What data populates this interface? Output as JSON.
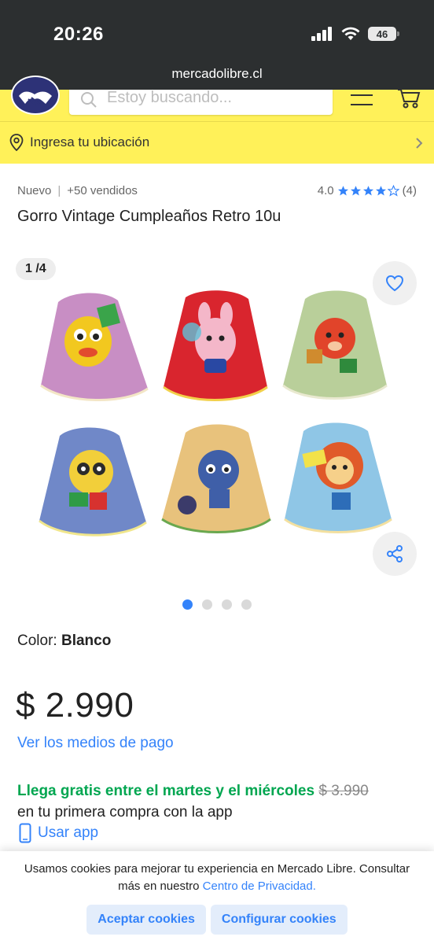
{
  "status_bar": {
    "time": "20:26",
    "battery": "46"
  },
  "browser": {
    "url": "mercadolibre.cl"
  },
  "header": {
    "search_placeholder": "Estoy buscando...",
    "location_label": "Ingresa tu ubicación",
    "brand_color": "#fff159"
  },
  "product": {
    "condition": "Nuevo",
    "sold": "+50 vendidos",
    "rating_value": "4.0",
    "rating_count": "(4)",
    "rating_stars": 4,
    "title": "Gorro Vintage Cumpleaños Retro 10u",
    "image_counter": "1 /4",
    "color_label": "Color:",
    "color_value": "Blanco",
    "price": "$ 2.990",
    "payment_link": "Ver los medios de pago",
    "shipping_highlight": "Llega gratis entre el martes y el miércoles",
    "old_price": "$ 3.990",
    "shipping_note": "en tu primera compra con la app",
    "use_app": "Usar app"
  },
  "gallery": {
    "total_images": 4,
    "active_index": 0
  },
  "cookies": {
    "text": "Usamos cookies para mejorar tu experiencia en Mercado Libre. Consultar más en nuestro",
    "link": "Centro de Privacidad.",
    "accept": "Aceptar cookies",
    "configure": "Configurar cookies"
  },
  "colors": {
    "accent": "#3483fa",
    "success": "#00a650"
  }
}
